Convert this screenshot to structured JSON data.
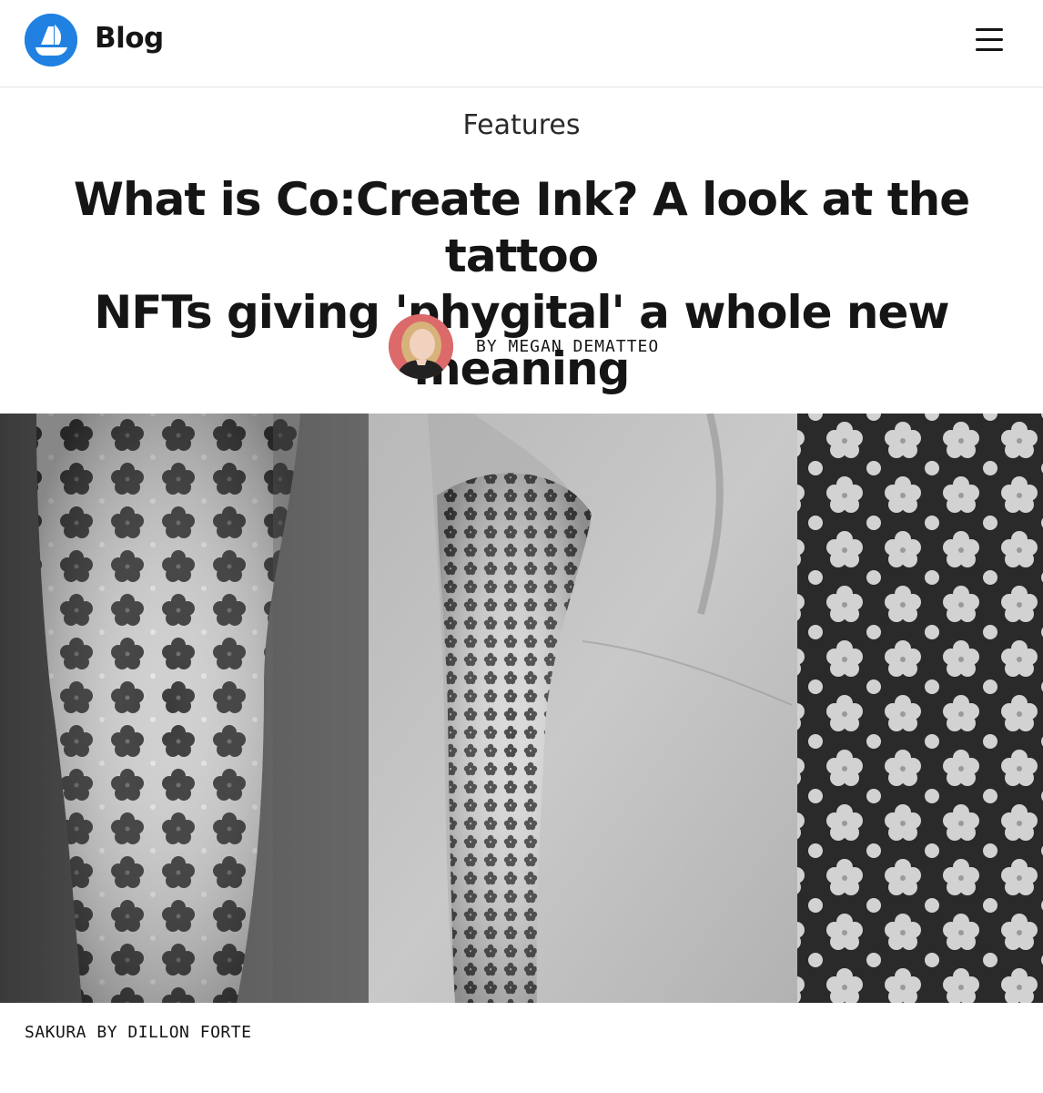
{
  "header": {
    "logo_icon": "opensea-ship-icon",
    "brand_color": "#2081e2",
    "title": "Blog",
    "menu_icon": "hamburger-menu-icon"
  },
  "article": {
    "category": "Features",
    "headline_line1": "What is Co:Create Ink? A look at the tattoo",
    "headline_line2": "NFTs giving 'phygital' a whole new meaning",
    "byline": "BY MEGAN DEMATTEO",
    "author_avatar_icon": "author-avatar",
    "hero_image_caption": "SAKURA BY DILLON FORTE"
  }
}
